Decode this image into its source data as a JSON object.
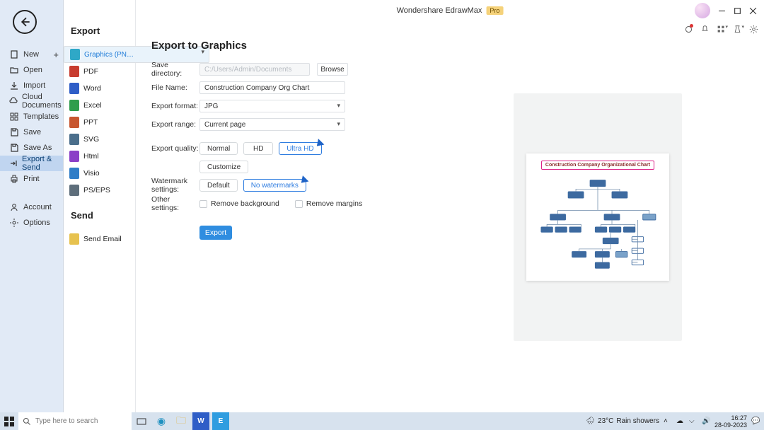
{
  "window": {
    "title": "Wondershare EdrawMax",
    "badge": "Pro"
  },
  "left_menu": {
    "items": [
      {
        "label": "New",
        "has_plus": true
      },
      {
        "label": "Open"
      },
      {
        "label": "Import"
      },
      {
        "label": "Cloud Documents"
      },
      {
        "label": "Templates"
      },
      {
        "label": "Save"
      },
      {
        "label": "Save As"
      },
      {
        "label": "Export & Send",
        "selected": true
      },
      {
        "label": "Print"
      }
    ],
    "bottom": [
      {
        "label": "Account"
      },
      {
        "label": "Options"
      }
    ]
  },
  "col2": {
    "export_header": "Export",
    "send_header": "Send",
    "formats": [
      {
        "label": "Graphics (PNG, JPG e...",
        "cls": "gfx",
        "selected": true
      },
      {
        "label": "PDF",
        "cls": "pdf"
      },
      {
        "label": "Word",
        "cls": "word"
      },
      {
        "label": "Excel",
        "cls": "excel"
      },
      {
        "label": "PPT",
        "cls": "ppt"
      },
      {
        "label": "SVG",
        "cls": "svg"
      },
      {
        "label": "Html",
        "cls": "html"
      },
      {
        "label": "Visio",
        "cls": "visio"
      },
      {
        "label": "PS/EPS",
        "cls": "ps"
      }
    ],
    "send_items": [
      {
        "label": "Send Email",
        "cls": "mail"
      }
    ]
  },
  "main": {
    "title": "Export to Graphics",
    "labels": {
      "save_dir": "Save directory:",
      "file_name": "File Name:",
      "format": "Export format:",
      "range": "Export range:",
      "quality": "Export quality:",
      "watermark": "Watermark settings:",
      "other": "Other settings:"
    },
    "save_dir_placeholder": "C:/Users/Admin/Documents",
    "browse": "Browse",
    "file_name_value": "Construction Company Org Chart",
    "format_value": "JPG",
    "range_value": "Current page",
    "quality": {
      "normal": "Normal",
      "hd": "HD",
      "ultra": "Ultra HD",
      "active": "ultra"
    },
    "customize": "Customize",
    "watermark": {
      "default": "Default",
      "none": "No watermarks",
      "active": "none"
    },
    "other": {
      "remove_bg": "Remove background",
      "remove_margins": "Remove margins"
    },
    "export_btn": "Export",
    "preview_title": "Construction Company Organizational Chart"
  },
  "taskbar": {
    "search_placeholder": "Type here to search",
    "weather_temp": "23°C",
    "weather_text": "Rain showers",
    "time": "16:27",
    "date": "28-09-2023"
  }
}
